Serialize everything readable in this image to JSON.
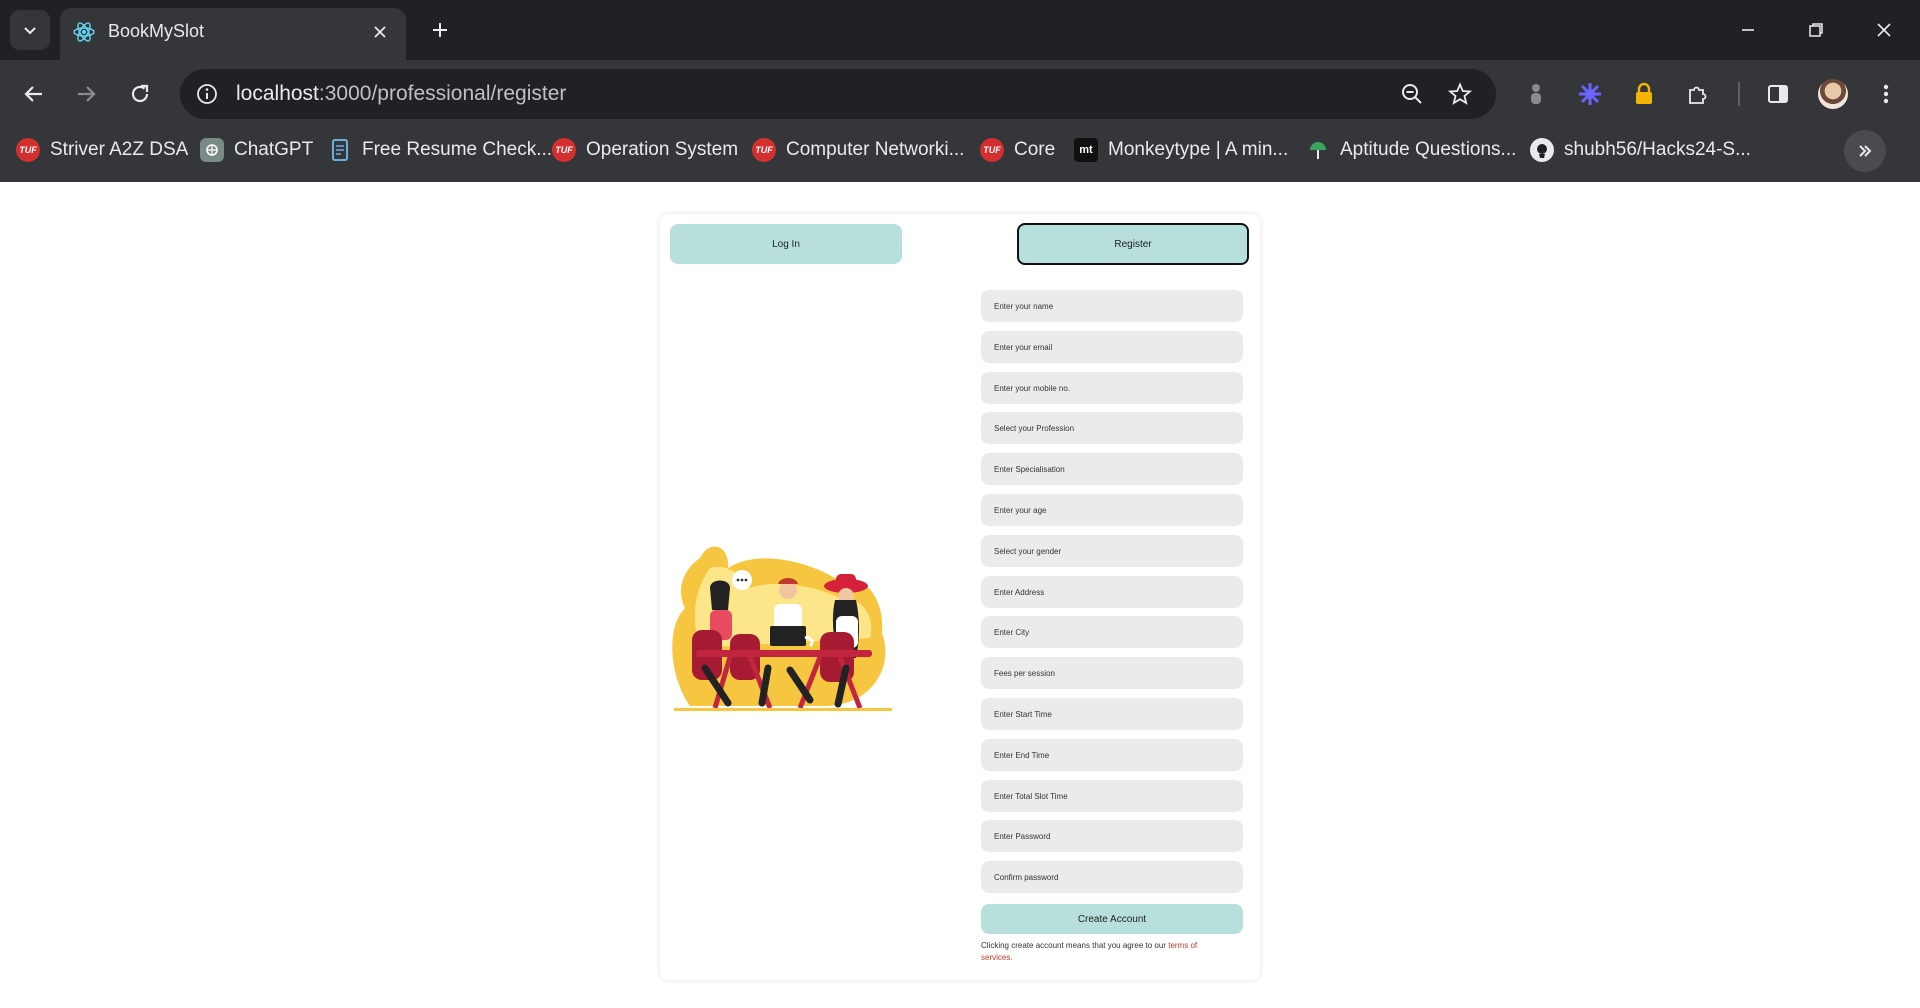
{
  "browser": {
    "tab_title": "BookMySlot",
    "url_host": "localhost",
    "url_rest": ":3000/professional/register",
    "bookmarks": [
      {
        "label": "Striver A2Z DSA",
        "icon": "tuf-icon"
      },
      {
        "label": "ChatGPT",
        "icon": "chatgpt-icon"
      },
      {
        "label": "Free Resume Check...",
        "icon": "resume-icon"
      },
      {
        "label": "Operation System",
        "icon": "tuf-icon"
      },
      {
        "label": "Computer Networki...",
        "icon": "tuf-icon"
      },
      {
        "label": "Core",
        "icon": "tuf-icon"
      },
      {
        "label": "Monkeytype | A min...",
        "icon": "monkeytype-icon"
      },
      {
        "label": "Aptitude Questions...",
        "icon": "aptitude-icon"
      },
      {
        "label": "shubh56/Hacks24-S...",
        "icon": "github-icon"
      }
    ]
  },
  "auth": {
    "login_tab": "Log In",
    "register_tab": "Register"
  },
  "form": {
    "fields": [
      "Enter your name",
      "Enter your email",
      "Enter your mobile no.",
      "Select your Profession",
      "Enter Specialisation",
      "Enter your age",
      "Select your gender",
      "Enter Address",
      "Enter City",
      "Fees per session",
      "Enter Start Time",
      "Enter End Time",
      "Enter Total Slot Time",
      "Enter Password",
      "Confirm password"
    ],
    "submit_label": "Create Account",
    "terms_prefix": "Clicking create account means that you agree to our ",
    "terms_link": "terms of services."
  },
  "colors": {
    "accent": "#b7e0dc",
    "field_bg": "#ebebeb",
    "link": "#c0392b"
  }
}
